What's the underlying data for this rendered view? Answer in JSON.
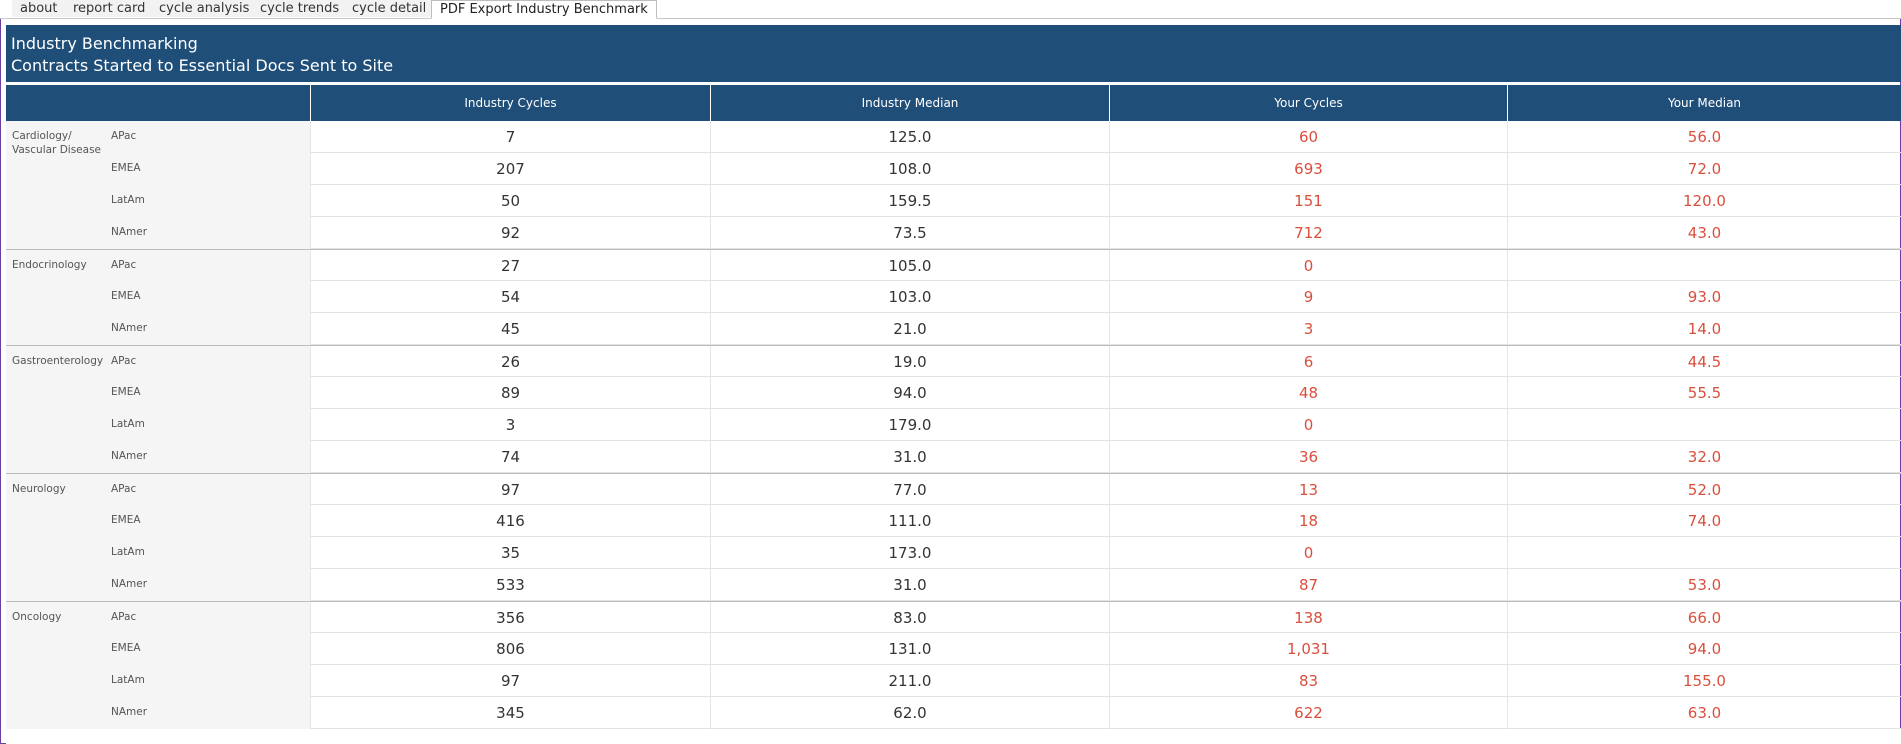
{
  "tabs": [
    "about",
    "report card",
    "cycle analysis",
    "cycle trends",
    "cycle detail",
    "PDF Export Industry Benchmark"
  ],
  "active_tab": 5,
  "banner": {
    "title": "Industry Benchmarking",
    "subtitle": "Contracts Started to Essential Docs Sent to Site"
  },
  "columns": [
    "Industry Cycles",
    "Industry Median",
    "Your Cycles",
    "Your Median"
  ],
  "colors": {
    "header_bg": "#1f4e79",
    "your_values": "#d94f3d"
  },
  "groups": [
    {
      "name": "Cardiology/ Vascular Disease",
      "rows": [
        {
          "region": "APac",
          "industry_cycles": "7",
          "industry_median": "125.0",
          "your_cycles": "60",
          "your_median": "56.0"
        },
        {
          "region": "EMEA",
          "industry_cycles": "207",
          "industry_median": "108.0",
          "your_cycles": "693",
          "your_median": "72.0"
        },
        {
          "region": "LatAm",
          "industry_cycles": "50",
          "industry_median": "159.5",
          "your_cycles": "151",
          "your_median": "120.0"
        },
        {
          "region": "NAmer",
          "industry_cycles": "92",
          "industry_median": "73.5",
          "your_cycles": "712",
          "your_median": "43.0"
        }
      ]
    },
    {
      "name": "Endocrinology",
      "rows": [
        {
          "region": "APac",
          "industry_cycles": "27",
          "industry_median": "105.0",
          "your_cycles": "0",
          "your_median": ""
        },
        {
          "region": "EMEA",
          "industry_cycles": "54",
          "industry_median": "103.0",
          "your_cycles": "9",
          "your_median": "93.0"
        },
        {
          "region": "NAmer",
          "industry_cycles": "45",
          "industry_median": "21.0",
          "your_cycles": "3",
          "your_median": "14.0"
        }
      ]
    },
    {
      "name": "Gastroenterology",
      "rows": [
        {
          "region": "APac",
          "industry_cycles": "26",
          "industry_median": "19.0",
          "your_cycles": "6",
          "your_median": "44.5"
        },
        {
          "region": "EMEA",
          "industry_cycles": "89",
          "industry_median": "94.0",
          "your_cycles": "48",
          "your_median": "55.5"
        },
        {
          "region": "LatAm",
          "industry_cycles": "3",
          "industry_median": "179.0",
          "your_cycles": "0",
          "your_median": ""
        },
        {
          "region": "NAmer",
          "industry_cycles": "74",
          "industry_median": "31.0",
          "your_cycles": "36",
          "your_median": "32.0"
        }
      ]
    },
    {
      "name": "Neurology",
      "rows": [
        {
          "region": "APac",
          "industry_cycles": "97",
          "industry_median": "77.0",
          "your_cycles": "13",
          "your_median": "52.0"
        },
        {
          "region": "EMEA",
          "industry_cycles": "416",
          "industry_median": "111.0",
          "your_cycles": "18",
          "your_median": "74.0"
        },
        {
          "region": "LatAm",
          "industry_cycles": "35",
          "industry_median": "173.0",
          "your_cycles": "0",
          "your_median": ""
        },
        {
          "region": "NAmer",
          "industry_cycles": "533",
          "industry_median": "31.0",
          "your_cycles": "87",
          "your_median": "53.0"
        }
      ]
    },
    {
      "name": "Oncology",
      "rows": [
        {
          "region": "APac",
          "industry_cycles": "356",
          "industry_median": "83.0",
          "your_cycles": "138",
          "your_median": "66.0"
        },
        {
          "region": "EMEA",
          "industry_cycles": "806",
          "industry_median": "131.0",
          "your_cycles": "1,031",
          "your_median": "94.0"
        },
        {
          "region": "LatAm",
          "industry_cycles": "97",
          "industry_median": "211.0",
          "your_cycles": "83",
          "your_median": "155.0"
        },
        {
          "region": "NAmer",
          "industry_cycles": "345",
          "industry_median": "62.0",
          "your_cycles": "622",
          "your_median": "63.0"
        }
      ]
    }
  ]
}
